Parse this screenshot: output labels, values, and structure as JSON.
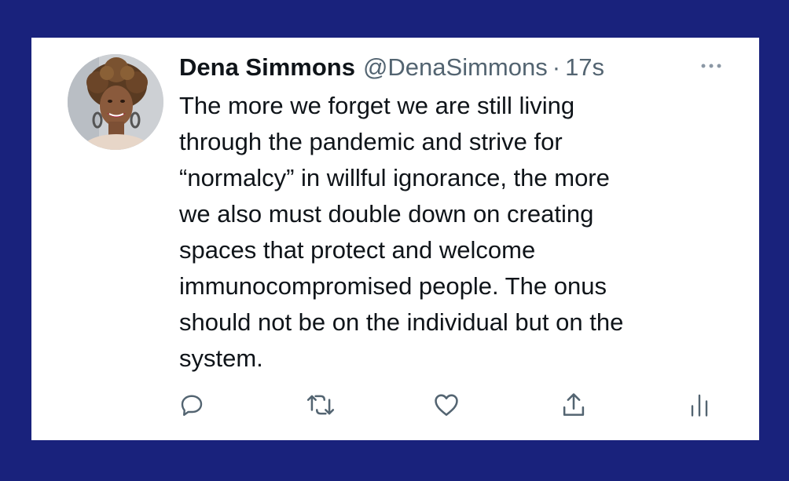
{
  "tweet": {
    "author_name": "Dena Simmons",
    "author_handle": "@DenaSimmons",
    "separator": "·",
    "time": "17s",
    "text": "The more we forget we are still living\nthrough the pandemic and strive for\n“normalcy” in willful ignorance, the more\nwe also must double down on creating\nspaces that protect and welcome\nimmunocompromised people. The onus\nshould not be on the individual but on the\nsystem."
  },
  "icons": {
    "more": "more-options-icon",
    "reply": "reply-icon",
    "retweet": "retweet-icon",
    "like": "heart-icon",
    "share": "share-icon",
    "analytics": "analytics-icon"
  },
  "colors": {
    "frame": "#19227c",
    "card": "#ffffff",
    "text": "#0f1419",
    "secondary": "#536471"
  }
}
